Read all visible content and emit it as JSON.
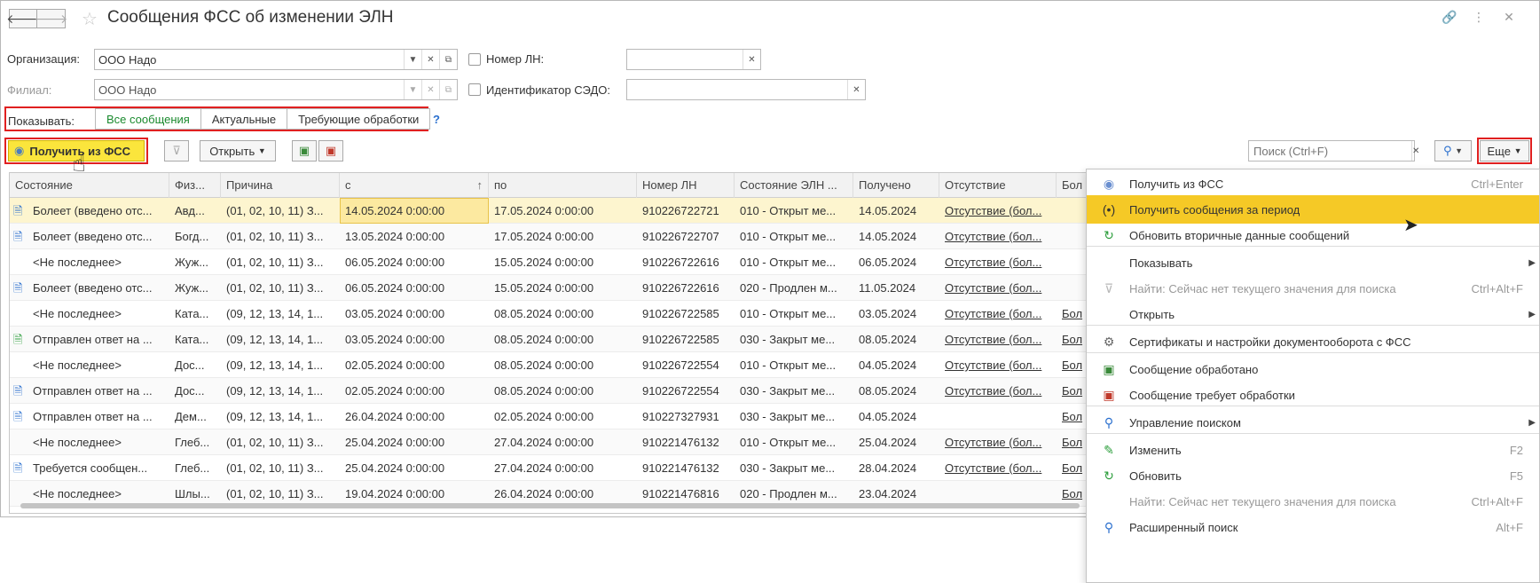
{
  "window": {
    "title": "Сообщения ФСС об изменении ЭЛН",
    "back_icon": "arrow-left-icon",
    "forward_icon": "arrow-right-icon"
  },
  "filters": {
    "organization_label": "Организация:",
    "organization_value": "ООО Надо",
    "branch_label": "Филиал:",
    "branch_value": "ООО Надо",
    "ln_number_label": "Номер ЛН:",
    "ln_number_value": "",
    "sedo_label": "Идентификатор СЭДО:",
    "sedo_value": ""
  },
  "show": {
    "label": "Показывать:",
    "tabs": [
      "Все сообщения",
      "Актуальные",
      "Требующие обработки"
    ],
    "active_index": 0,
    "help": "?"
  },
  "toolbar": {
    "get_from_fss": "Получить из ФСС",
    "open": "Открыть",
    "search_placeholder": "Поиск (Ctrl+F)",
    "more": "Еще"
  },
  "table": {
    "columns": [
      "Состояние",
      "Физ...",
      "Причина",
      "с",
      "по",
      "Номер ЛН",
      "Состояние ЭЛН ...",
      "Получено",
      "Отсутствие",
      "Бол"
    ],
    "sort_mark": "↑",
    "rows": [
      {
        "icon": "doc-arrow",
        "state": "Болеет (введено отс...",
        "person": "Авд...",
        "reason": "(01, 02, 10, 11) З...",
        "from": "14.05.2024 0:00:00",
        "to": "17.05.2024 0:00:00",
        "ln": "910226722721",
        "eln": "010 - Открыт ме...",
        "received": "14.05.2024",
        "absence": "Отсутствие (бол...",
        "sick": ""
      },
      {
        "icon": "doc-arrow",
        "state": "Болеет (введено отс...",
        "person": "Богд...",
        "reason": "(01, 02, 10, 11) З...",
        "from": "13.05.2024 0:00:00",
        "to": "17.05.2024 0:00:00",
        "ln": "910226722707",
        "eln": "010 - Открыт ме...",
        "received": "14.05.2024",
        "absence": "Отсутствие (бол...",
        "sick": ""
      },
      {
        "icon": "",
        "state": "<Не последнее>",
        "person": "Жуж...",
        "reason": "(01, 02, 10, 11) З...",
        "from": "06.05.2024 0:00:00",
        "to": "15.05.2024 0:00:00",
        "ln": "910226722616",
        "eln": "010 - Открыт ме...",
        "received": "06.05.2024",
        "absence": "Отсутствие (бол...",
        "sick": ""
      },
      {
        "icon": "doc-arrow",
        "state": "Болеет (введено отс...",
        "person": "Жуж...",
        "reason": "(01, 02, 10, 11) З...",
        "from": "06.05.2024 0:00:00",
        "to": "15.05.2024 0:00:00",
        "ln": "910226722616",
        "eln": "020 - Продлен м...",
        "received": "11.05.2024",
        "absence": "Отсутствие (бол...",
        "sick": ""
      },
      {
        "icon": "",
        "state": "<Не последнее>",
        "person": "Ката...",
        "reason": "(09, 12, 13, 14, 1...",
        "from": "03.05.2024 0:00:00",
        "to": "08.05.2024 0:00:00",
        "ln": "910226722585",
        "eln": "010 - Открыт ме...",
        "received": "03.05.2024",
        "absence": "Отсутствие (бол...",
        "sick": "Бол"
      },
      {
        "icon": "doc-check",
        "state": "Отправлен ответ на ...",
        "person": "Ката...",
        "reason": "(09, 12, 13, 14, 1...",
        "from": "03.05.2024 0:00:00",
        "to": "08.05.2024 0:00:00",
        "ln": "910226722585",
        "eln": "030 - Закрыт ме...",
        "received": "08.05.2024",
        "absence": "Отсутствие (бол...",
        "sick": "Бол"
      },
      {
        "icon": "",
        "state": "<Не последнее>",
        "person": "Дос...",
        "reason": "(09, 12, 13, 14, 1...",
        "from": "02.05.2024 0:00:00",
        "to": "08.05.2024 0:00:00",
        "ln": "910226722554",
        "eln": "010 - Открыт ме...",
        "received": "04.05.2024",
        "absence": "Отсутствие (бол...",
        "sick": "Бол"
      },
      {
        "icon": "doc-arrow",
        "state": "Отправлен ответ на ...",
        "person": "Дос...",
        "reason": "(09, 12, 13, 14, 1...",
        "from": "02.05.2024 0:00:00",
        "to": "08.05.2024 0:00:00",
        "ln": "910226722554",
        "eln": "030 - Закрыт ме...",
        "received": "08.05.2024",
        "absence": "Отсутствие (бол...",
        "sick": "Бол"
      },
      {
        "icon": "doc-arrow",
        "state": "Отправлен ответ на ...",
        "person": "Дем...",
        "reason": "(09, 12, 13, 14, 1...",
        "from": "26.04.2024 0:00:00",
        "to": "02.05.2024 0:00:00",
        "ln": "910227327931",
        "eln": "030 - Закрыт ме...",
        "received": "04.05.2024",
        "absence": "",
        "sick": "Бол"
      },
      {
        "icon": "",
        "state": "<Не последнее>",
        "person": "Глеб...",
        "reason": "(01, 02, 10, 11) З...",
        "from": "25.04.2024 0:00:00",
        "to": "27.04.2024 0:00:00",
        "ln": "910221476132",
        "eln": "010 - Открыт ме...",
        "received": "25.04.2024",
        "absence": "Отсутствие (бол...",
        "sick": "Бол"
      },
      {
        "icon": "doc",
        "state": "Требуется сообщен...",
        "person": "Глеб...",
        "reason": "(01, 02, 10, 11) З...",
        "from": "25.04.2024 0:00:00",
        "to": "27.04.2024 0:00:00",
        "ln": "910221476132",
        "eln": "030 - Закрыт ме...",
        "received": "28.04.2024",
        "absence": "Отсутствие (бол...",
        "sick": "Бол"
      },
      {
        "icon": "",
        "state": "<Не последнее>",
        "person": "Шлы...",
        "reason": "(01, 02, 10, 11) З...",
        "from": "19.04.2024 0:00:00",
        "to": "26.04.2024 0:00:00",
        "ln": "910221476816",
        "eln": "020 - Продлен м...",
        "received": "23.04.2024",
        "absence": "",
        "sick": "Бол"
      }
    ]
  },
  "menu": {
    "items": [
      {
        "label": "Получить из ФСС",
        "hotkey": "Ctrl+Enter",
        "icon": "fss-icon",
        "glyph": "◉",
        "color": "#6a8fd0"
      },
      {
        "label": "Получить сообщения за период",
        "hotkey": "",
        "icon": "broadcast-icon",
        "glyph": "(•)",
        "color": "#333333",
        "highlighted": true
      },
      {
        "label": "Обновить вторичные данные сообщений",
        "hotkey": "",
        "icon": "refresh-icon",
        "glyph": "↻",
        "color": "#2a9d3a"
      },
      {
        "label": "Показывать",
        "hotkey": "",
        "icon": "",
        "glyph": "",
        "submenu": true
      },
      {
        "label": "Найти: Сейчас нет текущего значения для поиска",
        "hotkey": "Ctrl+Alt+F",
        "icon": "find-filter-icon",
        "glyph": "⊽",
        "color": "#b8b8b8",
        "disabled": true
      },
      {
        "label": "Открыть",
        "hotkey": "",
        "icon": "",
        "glyph": "",
        "submenu": true
      },
      {
        "label": "Сертификаты и настройки документооборота с ФСС",
        "hotkey": "",
        "icon": "gear-icon",
        "glyph": "⚙",
        "color": "#666666"
      },
      {
        "label": "Сообщение обработано",
        "hotkey": "",
        "icon": "doc-processed-icon",
        "glyph": "▣",
        "color": "#3a8a3a"
      },
      {
        "label": "Сообщение требует обработки",
        "hotkey": "",
        "icon": "doc-needs-processing-icon",
        "glyph": "▣",
        "color": "#c0392b"
      },
      {
        "label": "Управление поиском",
        "hotkey": "",
        "icon": "search-icon",
        "glyph": "⚲",
        "color": "#2a6fce",
        "submenu": true
      },
      {
        "label": "Изменить",
        "hotkey": "F2",
        "icon": "pencil-icon",
        "glyph": "✎",
        "color": "#2a9d3a"
      },
      {
        "label": "Обновить",
        "hotkey": "F5",
        "icon": "refresh-icon",
        "glyph": "↻",
        "color": "#2a9d3a"
      },
      {
        "label": "Найти: Сейчас нет текущего значения для поиска",
        "hotkey": "Ctrl+Alt+F",
        "icon": "",
        "glyph": "",
        "disabled": true
      },
      {
        "label": "Расширенный поиск",
        "hotkey": "Alt+F",
        "icon": "advanced-search-icon",
        "glyph": "⚲",
        "color": "#2a6fce"
      }
    ]
  }
}
